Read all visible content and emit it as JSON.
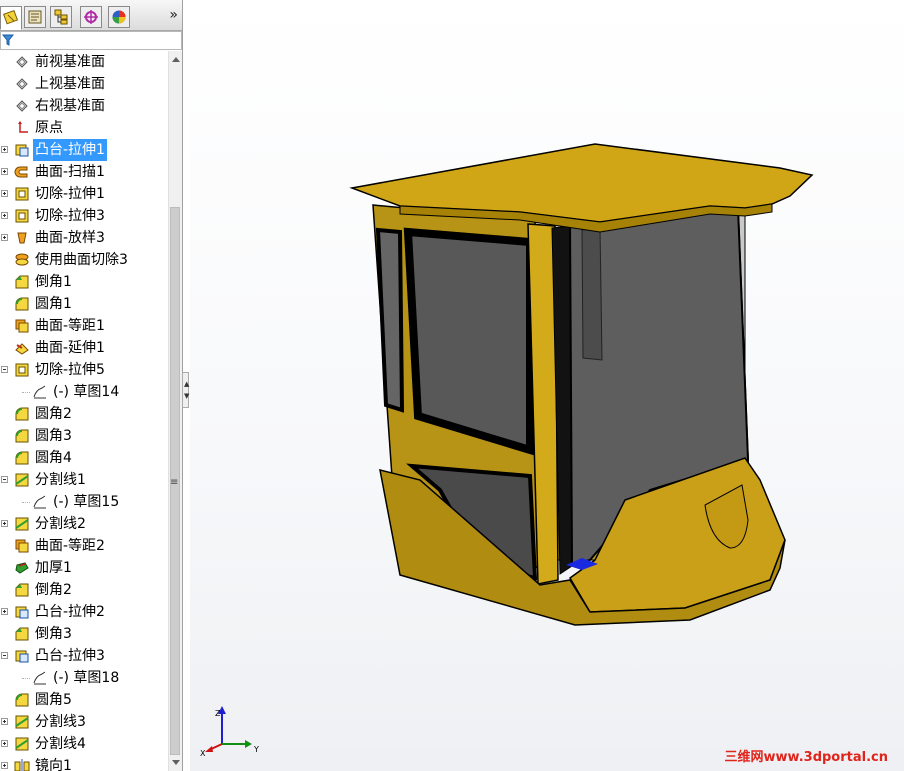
{
  "panel": {
    "tabs": [
      {
        "icon": "feature-manager-icon",
        "active": true
      },
      {
        "icon": "property-manager-icon",
        "active": false
      },
      {
        "icon": "configuration-manager-icon",
        "active": false
      },
      {
        "icon": "dimxpert-manager-icon",
        "active": false
      },
      {
        "icon": "display-manager-icon",
        "active": false
      }
    ],
    "expand_glyph": "»",
    "filter_icon": "filter-icon"
  },
  "tree": [
    {
      "label": "前视基准面",
      "indent": 0,
      "icon": "plane-icon",
      "expander": "none"
    },
    {
      "label": "上视基准面",
      "indent": 0,
      "icon": "plane-icon",
      "expander": "none"
    },
    {
      "label": "右视基准面",
      "indent": 0,
      "icon": "plane-icon",
      "expander": "none"
    },
    {
      "label": "原点",
      "indent": 0,
      "icon": "origin-icon",
      "expander": "none"
    },
    {
      "label": "凸台-拉伸1",
      "indent": 0,
      "icon": "boss-extrude-icon",
      "expander": "plus",
      "selected": true
    },
    {
      "label": "曲面-扫描1",
      "indent": 0,
      "icon": "surface-sweep-icon",
      "expander": "plus"
    },
    {
      "label": "切除-拉伸1",
      "indent": 0,
      "icon": "cut-extrude-icon",
      "expander": "plus"
    },
    {
      "label": "切除-拉伸3",
      "indent": 0,
      "icon": "cut-extrude-icon",
      "expander": "plus"
    },
    {
      "label": "曲面-放样3",
      "indent": 0,
      "icon": "surface-loft-icon",
      "expander": "plus"
    },
    {
      "label": "使用曲面切除3",
      "indent": 0,
      "icon": "surface-cut-icon",
      "expander": "none"
    },
    {
      "label": "倒角1",
      "indent": 0,
      "icon": "chamfer-icon",
      "expander": "none"
    },
    {
      "label": "圆角1",
      "indent": 0,
      "icon": "fillet-icon",
      "expander": "none"
    },
    {
      "label": "曲面-等距1",
      "indent": 0,
      "icon": "surface-offset-icon",
      "expander": "none"
    },
    {
      "label": "曲面-延伸1",
      "indent": 0,
      "icon": "surface-extend-icon",
      "expander": "none"
    },
    {
      "label": "切除-拉伸5",
      "indent": 0,
      "icon": "cut-extrude-icon",
      "expander": "minus"
    },
    {
      "label": "(-) 草图14",
      "indent": 1,
      "icon": "sketch-icon",
      "expander": "none"
    },
    {
      "label": "圆角2",
      "indent": 0,
      "icon": "fillet-icon",
      "expander": "none"
    },
    {
      "label": "圆角3",
      "indent": 0,
      "icon": "fillet-icon",
      "expander": "none"
    },
    {
      "label": "圆角4",
      "indent": 0,
      "icon": "fillet-icon",
      "expander": "none"
    },
    {
      "label": "分割线1",
      "indent": 0,
      "icon": "split-line-icon",
      "expander": "minus"
    },
    {
      "label": "(-) 草图15",
      "indent": 1,
      "icon": "sketch-icon",
      "expander": "none"
    },
    {
      "label": "分割线2",
      "indent": 0,
      "icon": "split-line-icon",
      "expander": "plus"
    },
    {
      "label": "曲面-等距2",
      "indent": 0,
      "icon": "surface-offset-icon",
      "expander": "none"
    },
    {
      "label": "加厚1",
      "indent": 0,
      "icon": "thicken-icon",
      "expander": "none"
    },
    {
      "label": "倒角2",
      "indent": 0,
      "icon": "chamfer-icon",
      "expander": "none"
    },
    {
      "label": "凸台-拉伸2",
      "indent": 0,
      "icon": "boss-extrude-icon",
      "expander": "plus"
    },
    {
      "label": "倒角3",
      "indent": 0,
      "icon": "chamfer-icon",
      "expander": "none"
    },
    {
      "label": "凸台-拉伸3",
      "indent": 0,
      "icon": "boss-extrude-icon",
      "expander": "minus"
    },
    {
      "label": "(-) 草图18",
      "indent": 1,
      "icon": "sketch-icon",
      "expander": "none"
    },
    {
      "label": "圆角5",
      "indent": 0,
      "icon": "fillet-icon",
      "expander": "none"
    },
    {
      "label": "分割线3",
      "indent": 0,
      "icon": "split-line-icon",
      "expander": "plus"
    },
    {
      "label": "分割线4",
      "indent": 0,
      "icon": "split-line-icon",
      "expander": "plus"
    },
    {
      "label": "镜向1",
      "indent": 0,
      "icon": "mirror-icon",
      "expander": "plus"
    }
  ],
  "triad": {
    "x": "X",
    "y": "Y",
    "z": "Z"
  },
  "watermark": "三维网www.3dportal.cn",
  "colors": {
    "selection": "#3399ff",
    "body_yellow": "#c8a01a",
    "body_dark_yellow": "#8a6a08",
    "glass": "#5a5a5a",
    "watermark": "#e0241b"
  }
}
